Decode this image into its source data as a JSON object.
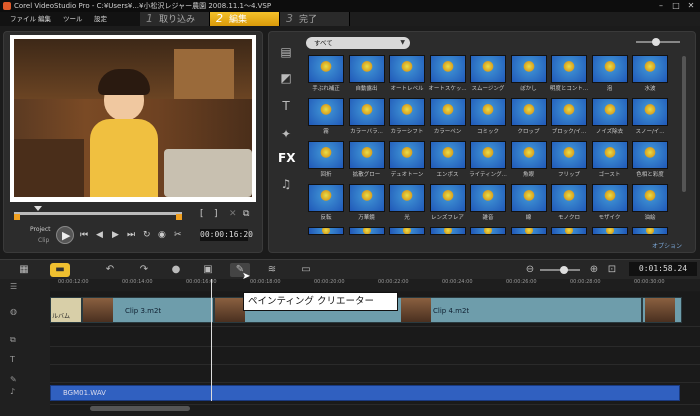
{
  "titlebar": {
    "title": "Corel VideoStudio Pro - C:¥Users¥...¥小松沢レジャー農園 2008.11.1～4.VSP"
  },
  "menu": {
    "file": "ファイル",
    "edit": "編集",
    "tools": "ツール",
    "settings": "設定"
  },
  "steps": [
    {
      "num": "1",
      "label": "取り込み"
    },
    {
      "num": "2",
      "label": "編集"
    },
    {
      "num": "3",
      "label": "完了"
    }
  ],
  "preview": {
    "project_label": "Project",
    "clip_label": "Clip",
    "timecode": "00:00:16:20"
  },
  "library": {
    "filter_value": "すべて",
    "options_label": "オプション",
    "fx_label": "FX",
    "thumbnails": [
      "手ぶれ補正",
      "自動露出",
      "オートレベル",
      "オートスケッ...",
      "スムージング",
      "ぼかし",
      "明度とコント...",
      "泡",
      "水波",
      "霧",
      "カラーバラ...",
      "カラーシフト",
      "カラーペン",
      "コミック",
      "クロップ",
      "ブロック/イ...",
      "ノイズ除去",
      "スノー/イ...",
      "回折",
      "拡散グロー",
      "デュオトーン",
      "エンボス",
      "ライティング...",
      "魚眼",
      "フリップ",
      "ゴースト",
      "色相と彩度",
      "反転",
      "万華鏡",
      "光",
      "レンズフレア",
      "雑音",
      "線",
      "モノクロ",
      "モザイク",
      "油絵",
      "",
      "",
      "",
      "",
      "",
      "",
      "",
      "",
      ""
    ]
  },
  "toolbar": {
    "timecode": "0:01:58.24"
  },
  "timeline": {
    "ticks": [
      "00:00:12:00",
      "00:00:14:00",
      "00:00:16:00",
      "00:00:18:00",
      "00:00:20:00",
      "00:00:22:00",
      "00:00:24:00",
      "00:00:26:00",
      "00:00:28:00",
      "00:00:30:00"
    ],
    "clip1_label": "Clip 3.m2t",
    "clip2_label": "Clip 4.m2t",
    "clip0_label": "ルバム",
    "audio_label": "BGM01.WAV"
  },
  "tooltip": {
    "text": "ペインティング クリエーター"
  }
}
